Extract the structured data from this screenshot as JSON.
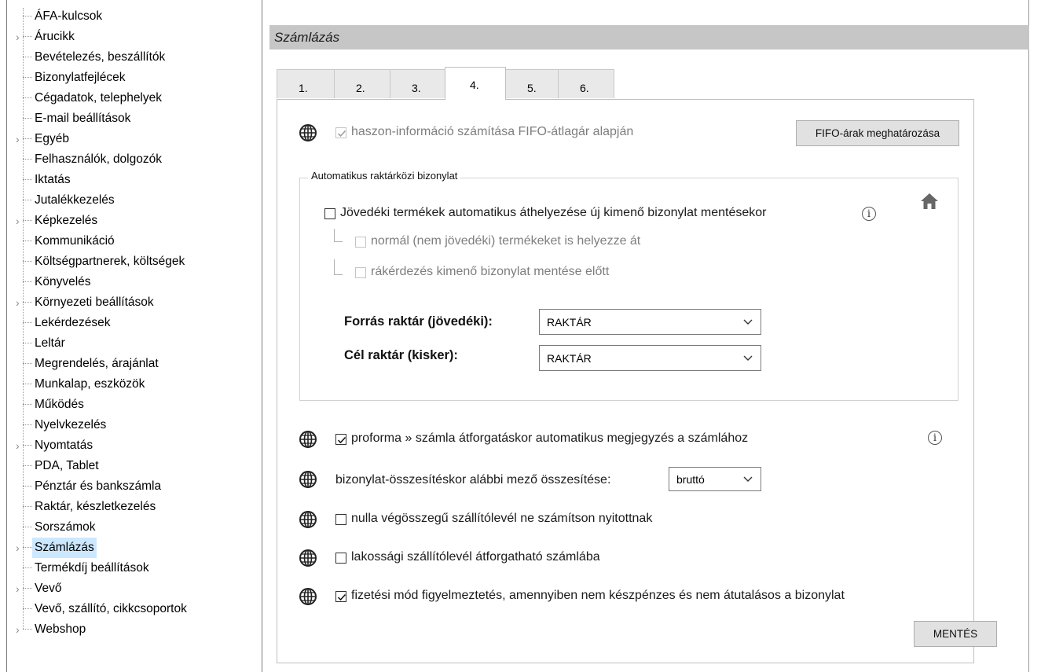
{
  "tree": {
    "items": [
      {
        "label": "ÁFA-kulcsok",
        "expandable": false
      },
      {
        "label": "Árucikk",
        "expandable": true
      },
      {
        "label": "Bevételezés, beszállítók",
        "expandable": false
      },
      {
        "label": "Bizonylatfejlécek",
        "expandable": false
      },
      {
        "label": "Cégadatok, telephelyek",
        "expandable": false
      },
      {
        "label": "E-mail beállítások",
        "expandable": false
      },
      {
        "label": "Egyéb",
        "expandable": true
      },
      {
        "label": "Felhasználók, dolgozók",
        "expandable": false
      },
      {
        "label": "Iktatás",
        "expandable": false
      },
      {
        "label": "Jutalékkezelés",
        "expandable": false
      },
      {
        "label": "Képkezelés",
        "expandable": true
      },
      {
        "label": "Kommunikáció",
        "expandable": false
      },
      {
        "label": "Költségpartnerek, költségek",
        "expandable": false
      },
      {
        "label": "Könyvelés",
        "expandable": false
      },
      {
        "label": "Környezeti beállítások",
        "expandable": true
      },
      {
        "label": "Lekérdezések",
        "expandable": false
      },
      {
        "label": "Leltár",
        "expandable": false
      },
      {
        "label": "Megrendelés, árajánlat",
        "expandable": false
      },
      {
        "label": "Munkalap, eszközök",
        "expandable": false
      },
      {
        "label": "Működés",
        "expandable": false
      },
      {
        "label": "Nyelvkezelés",
        "expandable": false
      },
      {
        "label": "Nyomtatás",
        "expandable": true
      },
      {
        "label": "PDA, Tablet",
        "expandable": false
      },
      {
        "label": "Pénztár és bankszámla",
        "expandable": false
      },
      {
        "label": "Raktár, készletkezelés",
        "expandable": false
      },
      {
        "label": "Sorszámok",
        "expandable": false
      },
      {
        "label": "Számlázás",
        "expandable": true,
        "selected": true
      },
      {
        "label": "Termékdíj beállítások",
        "expandable": false
      },
      {
        "label": "Vevő",
        "expandable": true
      },
      {
        "label": "Vevő, szállító, cikkcsoportok",
        "expandable": false
      },
      {
        "label": "Webshop",
        "expandable": true
      }
    ]
  },
  "panel": {
    "title": "Számlázás",
    "tabs": [
      "1.",
      "2.",
      "3.",
      "4.",
      "5.",
      "6."
    ],
    "active_tab": "4.",
    "fifo": {
      "label": "haszon-információ számítása FIFO-átlagár alapján",
      "checked": true,
      "disabled": true,
      "button": "FIFO-árak meghatározása"
    },
    "group": {
      "legend": "Automatikus raktárközi bizonylat",
      "main_check": {
        "label": "Jövedéki termékek automatikus áthelyezése új kimenő bizonylat mentésekor",
        "checked": false
      },
      "sub1": {
        "label": "normál (nem jövedéki) termékeket is helyezze át",
        "checked": false,
        "disabled": true
      },
      "sub2": {
        "label": "rákérdezés kimenő bizonylat mentése előtt",
        "checked": false,
        "disabled": true
      },
      "source_label": "Forrás raktár (jövedéki):",
      "source_value": "RAKTÁR",
      "target_label": "Cél raktár (kisker):",
      "target_value": "RAKTÁR"
    },
    "options": {
      "proforma": {
        "label": "proforma » számla átforgatáskor automatikus megjegyzés a számlához",
        "checked": true
      },
      "summary_label": "bizonylat-összesítéskor alábbi mező összesítése:",
      "summary_value": "bruttó",
      "zero_total": {
        "label": "nulla végösszegű szállítólevél ne számítson nyitottnak",
        "checked": false
      },
      "residential": {
        "label": "lakossági szállítólevél átforgatható számlába",
        "checked": false
      },
      "payment_warning": {
        "label": "fizetési mód figyelmeztetés, amennyiben nem készpénzes és nem átutalásos a bizonylat",
        "checked": true
      }
    },
    "save_button": "MENTÉS",
    "info_glyph": "i"
  }
}
